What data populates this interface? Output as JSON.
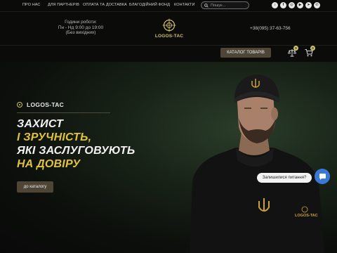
{
  "topnav": {
    "items": [
      "ПРО НАС",
      "ДЛЯ ПАРТНЕРІВ",
      "ОПЛАТА ТА ДОСТАВКА",
      "БЛАГОДІЙНИЙ ФОНД",
      "КОНТАКТИ"
    ]
  },
  "search": {
    "placeholder": "Пошук..."
  },
  "socials": [
    "tiktok-icon",
    "facebook-icon",
    "instagram-icon",
    "youtube-icon",
    "telegram-icon",
    "viber-icon"
  ],
  "header": {
    "hours_title": "Години роботи:",
    "hours_days": "Пн - Нд 9:00 до 19:00",
    "hours_note": "(Без вихідних)",
    "logo_text": "LOGOS-TAC",
    "phone": "+38(095) 37-63-756",
    "catalog_button": "КАТАЛОГ ТОВАРІВ",
    "compare_count": "0",
    "cart_count": "0"
  },
  "hero": {
    "brand": "LOGOS-TAC",
    "line1": "ЗАХИСТ",
    "line2": "І ЗРУЧНІСТЬ,",
    "line3": "ЯКІ ЗАСЛУГОВУЮТЬ",
    "line4": "НА ДОВІРУ",
    "cta": "до каталогу",
    "shirt_logo": "LOGOS-TAC"
  },
  "chat": {
    "label": "Залишилися питання?"
  },
  "colors": {
    "accent": "#e0c23c",
    "button": "#4e4536",
    "background": "#0b0b0a"
  }
}
